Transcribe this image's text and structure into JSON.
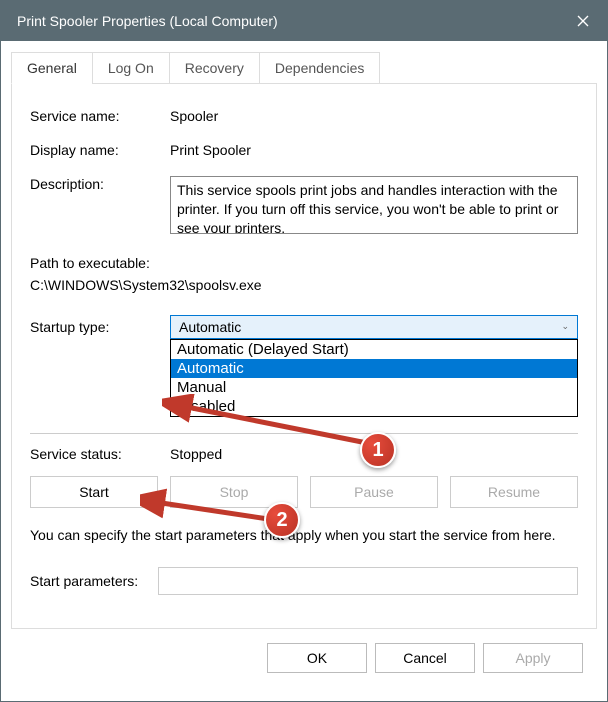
{
  "title": "Print Spooler Properties (Local Computer)",
  "tabs": [
    "General",
    "Log On",
    "Recovery",
    "Dependencies"
  ],
  "labels": {
    "service_name": "Service name:",
    "display_name": "Display name:",
    "description": "Description:",
    "path": "Path to executable:",
    "startup_type": "Startup type:",
    "service_status": "Service status:",
    "start_params": "Start parameters:"
  },
  "values": {
    "service_name": "Spooler",
    "display_name": "Print Spooler",
    "description": "This service spools print jobs and handles interaction with the printer.  If you turn off this service, you won't be able to print or see your printers.",
    "path": "C:\\WINDOWS\\System32\\spoolsv.exe",
    "startup_selected": "Automatic",
    "service_status": "Stopped",
    "start_params": ""
  },
  "startup_options": [
    "Automatic (Delayed Start)",
    "Automatic",
    "Manual",
    "Disabled"
  ],
  "action_buttons": {
    "start": "Start",
    "stop": "Stop",
    "pause": "Pause",
    "resume": "Resume"
  },
  "help_text": "You can specify the start parameters that apply when you start the service from here.",
  "dialog_buttons": {
    "ok": "OK",
    "cancel": "Cancel",
    "apply": "Apply"
  },
  "annotations": {
    "one": "1",
    "two": "2"
  }
}
